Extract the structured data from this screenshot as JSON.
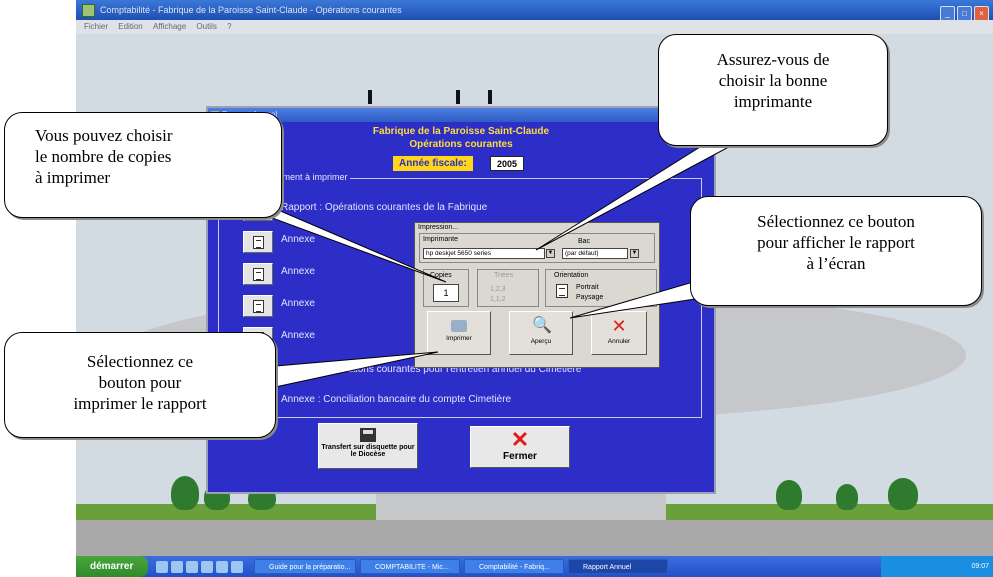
{
  "window": {
    "title": "Comptabilité - Fabrique de la Paroisse Saint-Claude - Opérations courantes",
    "menu": [
      "Fichier",
      "Edition",
      "Affichage",
      "Outils",
      "?"
    ]
  },
  "dialog": {
    "title": "Rapport Annuel",
    "header_line1": "Fabrique de la Paroisse Saint-Claude",
    "header_line2": "Opérations courantes",
    "fiscal_year_label": "Année fiscale:",
    "fiscal_year_value": "2005",
    "group_label": "Choix du document à imprimer",
    "documents": [
      {
        "label": "Rapport : Opérations courantes de la Fabrique"
      },
      {
        "label": "Annexe"
      },
      {
        "label": "Annexe"
      },
      {
        "label": "Annexe"
      },
      {
        "label": "Annexe"
      },
      {
        "label": "Rapport : Opérations courantes pour l'entretien annuel du Cimetière"
      },
      {
        "label": "Annexe : Conciliation bancaire du compte Cimetière"
      }
    ],
    "transfer_button": "Transfert sur disquette pour le Diocèse",
    "close_button": "Fermer"
  },
  "print_dialog": {
    "title": "Impression...",
    "printer_label": "Imprimante",
    "printer_value": "hp deskjet 5650 series",
    "tray_label": "Bac",
    "tray_value": "(par défaut)",
    "copies_label": "Copies",
    "copies_value": "1",
    "sorting_label": "Triées",
    "sorting_options": [
      "1,2,3",
      "1,1,2"
    ],
    "orientation_label": "Orientation",
    "orientation_options": [
      "Portrait",
      "Paysage"
    ],
    "print_button": "Imprimer",
    "preview_button": "Aperçu",
    "cancel_button": "Annuler"
  },
  "callouts": {
    "copies": "Vous pouvez choisir\nle nombre de copies\nà imprimer",
    "printer": "Assurez-vous de\nchoisir la bonne\nimprimante",
    "preview": "Sélectionnez ce bouton\npour afficher le rapport\nà l’écran",
    "print": "Sélectionnez ce\nbouton pour\nimprimer le rapport"
  },
  "taskbar": {
    "start": "démarrer",
    "tasks": [
      "Guide pour la préparatio...",
      "COMPTABILITE - Mic...",
      "Comptabilité - Fabriq...",
      "Rapport Annuel"
    ],
    "clock": "09:07"
  },
  "colors": {
    "dialog_bg": "#2d2dc8",
    "header_text": "#ffdf3a",
    "fiscal_label_bg": "#ffd61a",
    "cancel_red": "#e21d1d"
  }
}
